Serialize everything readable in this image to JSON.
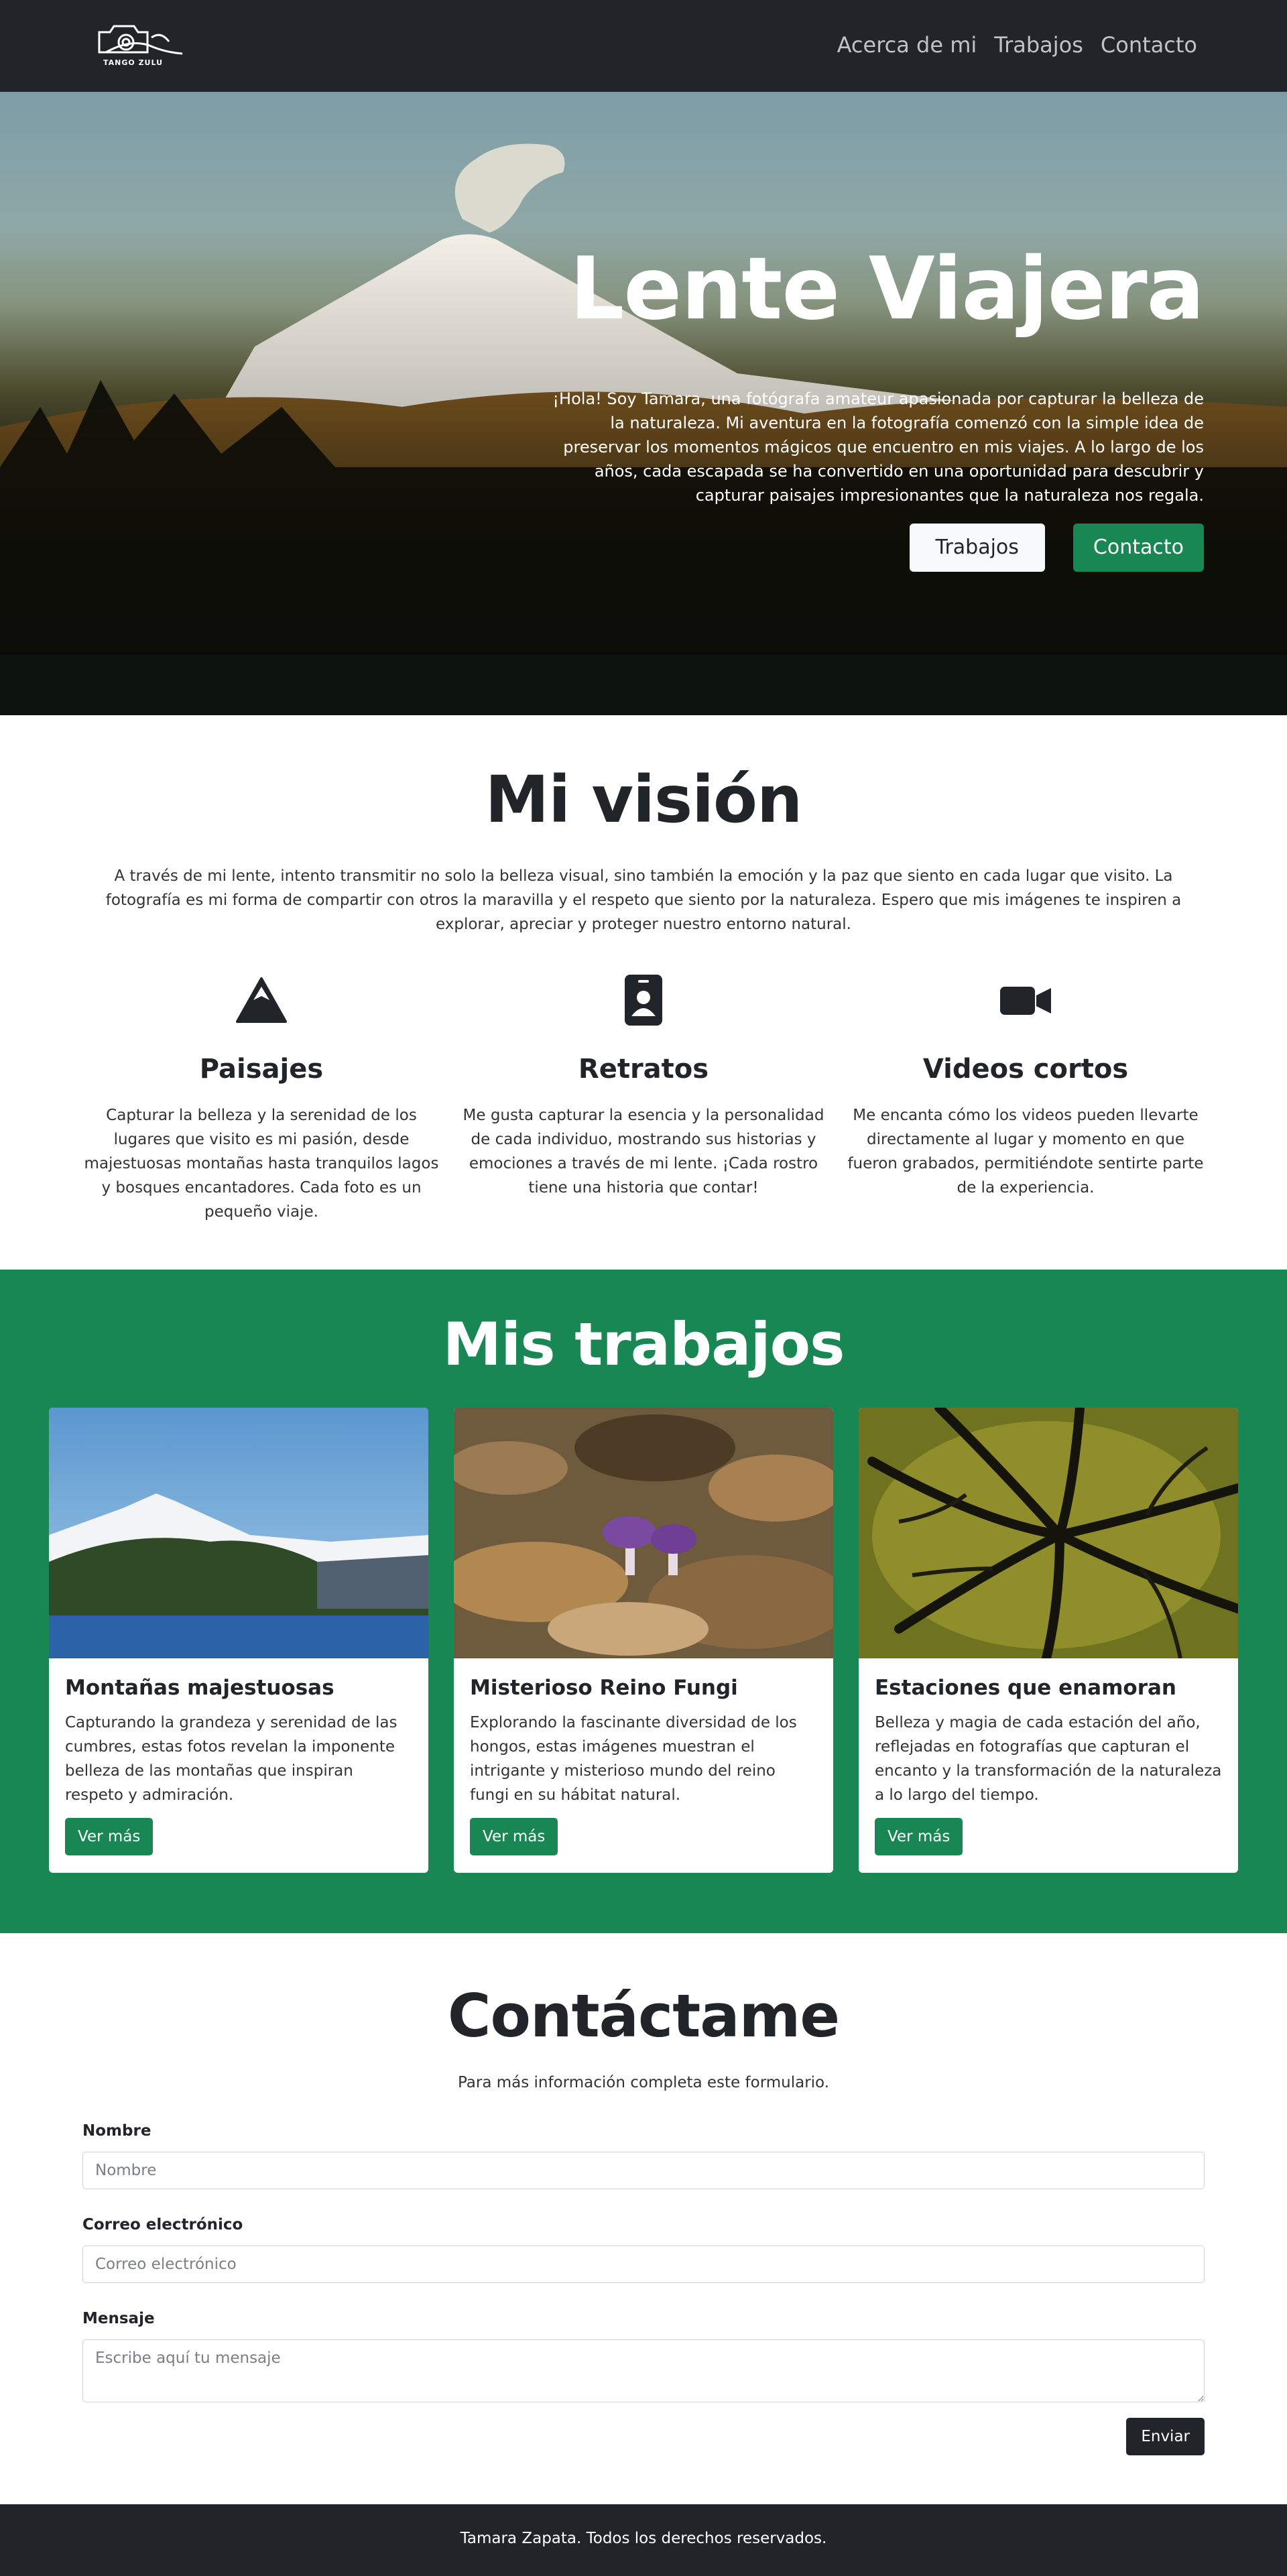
{
  "nav": {
    "logo_text": "TANGO ZULU",
    "links": [
      "Acerca de mi",
      "Trabajos",
      "Contacto"
    ]
  },
  "hero": {
    "title": "Lente Viajera",
    "text": "¡Hola! Soy Tamara, una fotógrafa amateur apasionada por capturar la belleza de la naturaleza. Mi aventura en la fotografía comenzó con la simple idea de preservar los momentos mágicos que encuentro en mis viajes. A lo largo de los años, cada escapada se ha convertido en una oportunidad para descubrir y capturar paisajes impresionantes que la naturaleza nos regala.",
    "btn_works": "Trabajos",
    "btn_contact": "Contacto"
  },
  "vision": {
    "title": "Mi visión",
    "intro": "A través de mi lente, intento transmitir no solo la belleza visual, sino también la emoción y la paz que siento en cada lugar que visito. La fotografía es mi forma de compartir con otros la maravilla y el respeto que siento por la naturaleza. Espero que mis imágenes te inspiren a explorar, apreciar y proteger nuestro entorno natural.",
    "features": [
      {
        "icon": "mountain-icon",
        "title": "Paisajes",
        "text": "Capturar la belleza y la serenidad de los lugares que visito es mi pasión, desde majestuosas montañas hasta tranquilos lagos y bosques encantadores. Cada foto es un pequeño viaje."
      },
      {
        "icon": "person-badge-icon",
        "title": "Retratos",
        "text": "Me gusta capturar la esencia y la personalidad de cada individuo, mostrando sus historias y emociones a través de mi lente. ¡Cada rostro tiene una historia que contar!"
      },
      {
        "icon": "video-camera-icon",
        "title": "Videos cortos",
        "text": "Me encanta cómo los videos pueden llevarte directamente al lugar y momento en que fueron grabados, permitiéndote sentirte parte de la experiencia."
      }
    ]
  },
  "works": {
    "title": "Mis trabajos",
    "cards": [
      {
        "title": "Montañas majestuosas",
        "text": "Capturando la grandeza y serenidad de las cumbres, estas fotos revelan la imponente belleza de las montañas que inspiran respeto y admiración.",
        "button": "Ver más"
      },
      {
        "title": "Misterioso Reino Fungi",
        "text": "Explorando la fascinante diversidad de los hongos, estas imágenes muestran el intrigante y misterioso mundo del reino fungi en su hábitat natural.",
        "button": "Ver más"
      },
      {
        "title": "Estaciones que enamoran",
        "text": "Belleza y magia de cada estación del año, reflejadas en fotografías que capturan el encanto y la transformación de la naturaleza a lo largo del tiempo.",
        "button": "Ver más"
      }
    ]
  },
  "contact": {
    "title": "Contáctame",
    "subtitle": "Para más información completa este formulario.",
    "name_label": "Nombre",
    "name_placeholder": "Nombre",
    "email_label": "Correo electrónico",
    "email_placeholder": "Correo electrónico",
    "message_label": "Mensaje",
    "message_placeholder": "Escribe aquí tu mensaje",
    "send": "Enviar"
  },
  "footer": {
    "text": "Tamara Zapata. Todos los derechos reservados."
  },
  "colors": {
    "dark": "#212529",
    "green": "#198754",
    "light": "#f8f9fa"
  }
}
